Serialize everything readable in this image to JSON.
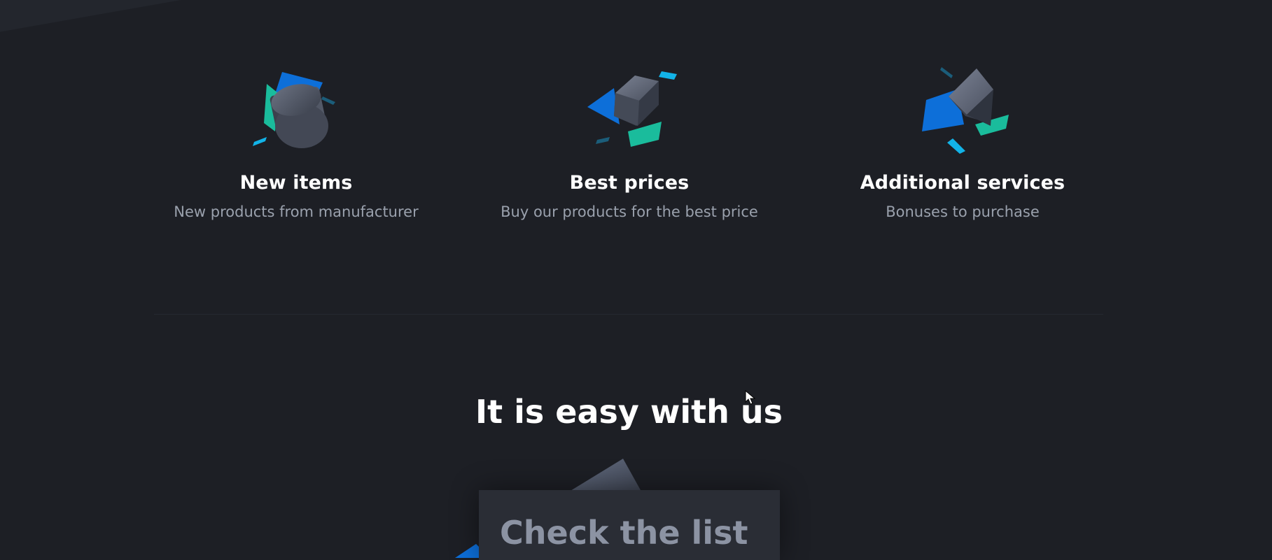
{
  "features": [
    {
      "icon": "cylinder-shapes-icon",
      "title": "New items",
      "subtitle": "New products from manufacturer"
    },
    {
      "icon": "cube-shapes-icon",
      "title": "Best prices",
      "subtitle": "Buy our products for the best price"
    },
    {
      "icon": "prism-shapes-icon",
      "title": "Additional services",
      "subtitle": "Bonuses to purchase"
    }
  ],
  "section": {
    "title": "It is easy with us"
  },
  "card": {
    "title": "Check the list"
  },
  "colors": {
    "background": "#1d1f25",
    "accent_blue": "#0d6fd9",
    "accent_teal": "#1abc9c",
    "accent_cyan": "#12b3e8",
    "card_background": "#2a2d35",
    "muted_text": "#9aa1ad"
  }
}
